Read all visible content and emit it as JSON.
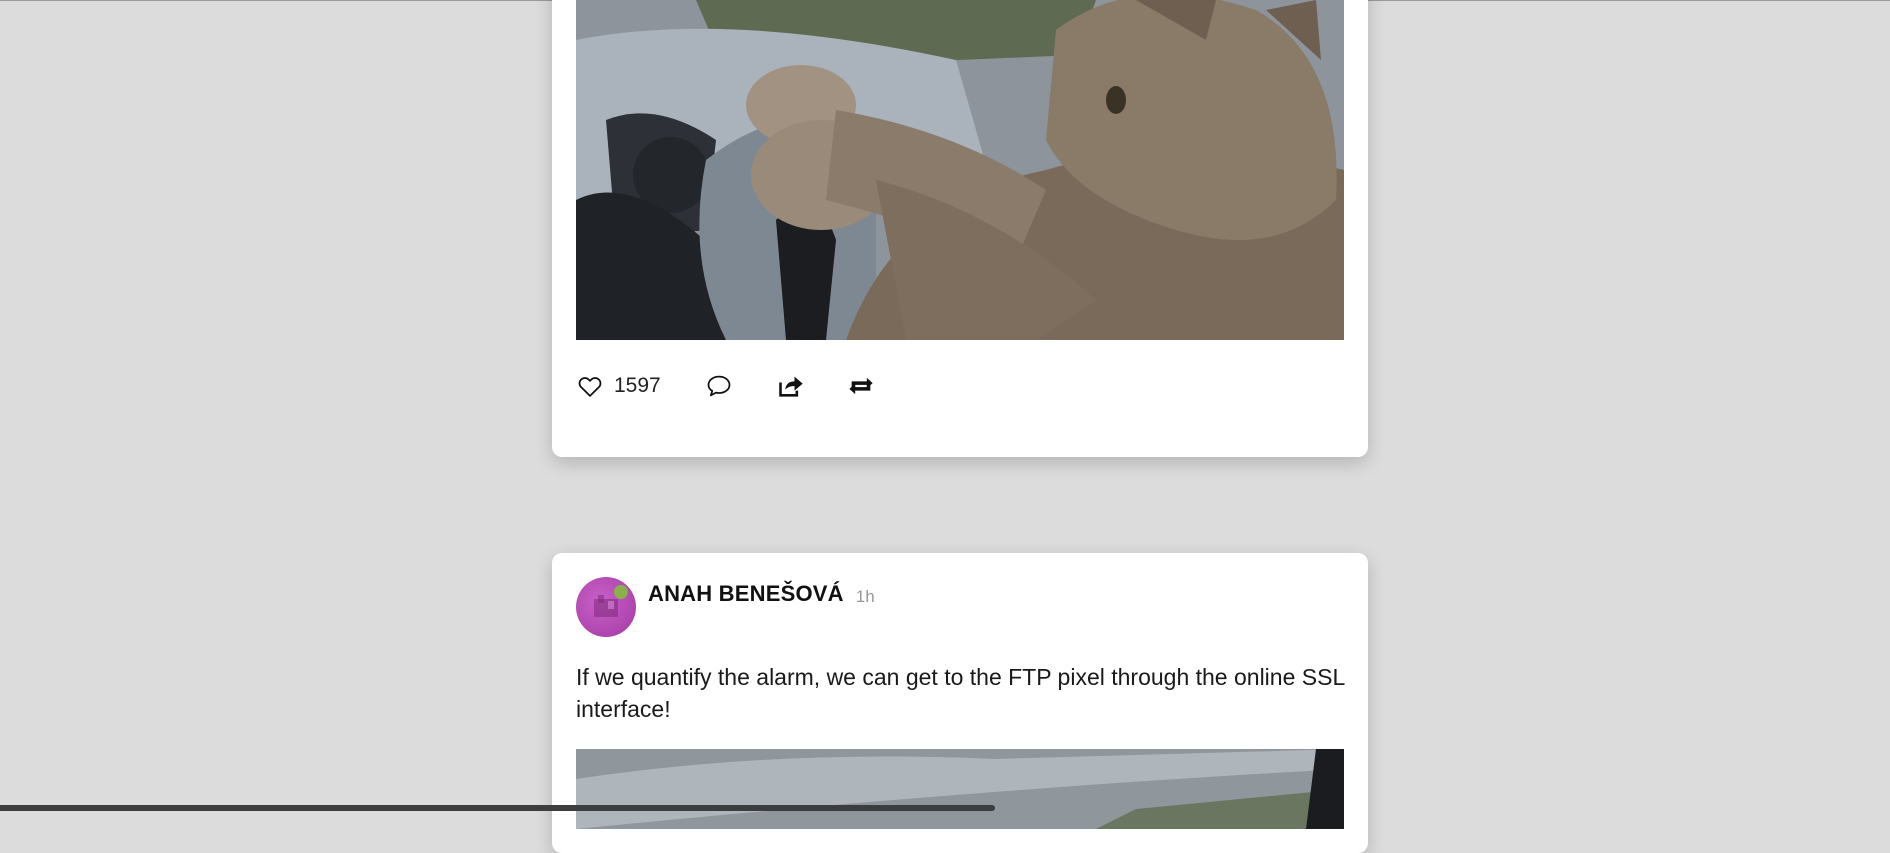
{
  "posts": [
    {
      "image": {
        "alt": "",
        "subject": "cat-driving-car"
      },
      "likes": "1597",
      "actions": {
        "like_icon": "heart-outline",
        "comment_icon": "speech-bubble",
        "share_icon": "share-arrow",
        "repost_icon": "repeat-arrows"
      }
    },
    {
      "author": "ANAH BENEŠOVÁ",
      "time": "1h",
      "avatar": {
        "color": "#b84bb8",
        "status_color": "#8bb04a"
      },
      "text": "If we quantify the alarm, we can get to the FTP pixel through the online SSL interface!",
      "image": {
        "alt": "",
        "subject": "cat-driving-car"
      }
    }
  ],
  "theme": {
    "background": "#dcdcdc",
    "card": "#ffffff",
    "secondary_text": "#999999"
  }
}
